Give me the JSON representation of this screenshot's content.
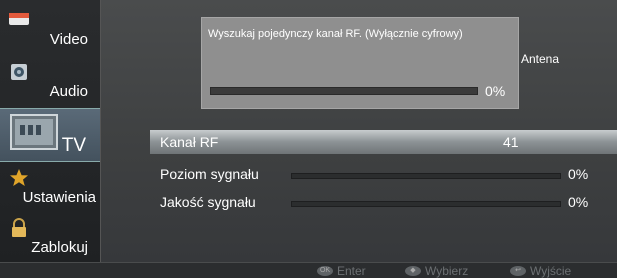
{
  "sidebar": {
    "items": [
      {
        "label": "Video",
        "icon": "video-icon"
      },
      {
        "label": "Audio",
        "icon": "audio-icon"
      },
      {
        "label": "TV",
        "icon": "tv-icon",
        "active": true
      },
      {
        "label": "Ustawienia",
        "icon": "settings-star-icon"
      },
      {
        "label": "Zablokuj",
        "icon": "lock-icon"
      }
    ]
  },
  "dialog": {
    "title": "Wyszukaj pojedynczy kanał RF. (Wyłącznie cyfrowy)",
    "progress_percent": "0%",
    "progress_value": 0
  },
  "antenna_label": "Antena",
  "rows": {
    "rf_channel": {
      "label": "Kanał RF",
      "value": "41"
    },
    "signal_level": {
      "label": "Poziom sygnału",
      "percent": "0%",
      "value": 0
    },
    "signal_quality": {
      "label": "Jakość sygnału",
      "percent": "0%",
      "value": 0
    }
  },
  "footer": {
    "enter": {
      "label": "Enter",
      "key": "OK"
    },
    "select": {
      "label": "Wybierz",
      "key": "◆"
    },
    "exit": {
      "label": "Wyjście",
      "key": "↩"
    }
  },
  "colors": {
    "highlight": "#8c9295",
    "dialog": "#8f8f8f",
    "footer_text": "#6c7073"
  }
}
